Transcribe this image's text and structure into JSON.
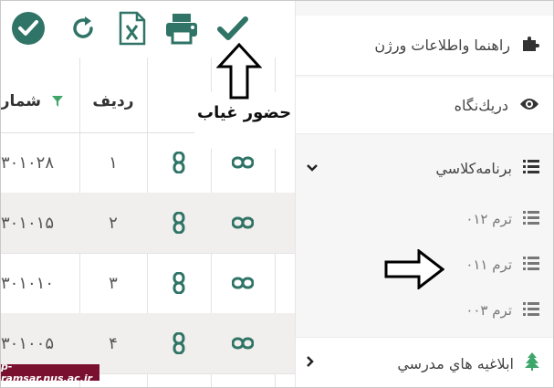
{
  "toolbar": {
    "buttons": [
      {
        "name": "check-circle-icon"
      },
      {
        "name": "refresh-icon"
      },
      {
        "name": "excel-export-icon"
      },
      {
        "name": "print-icon"
      },
      {
        "name": "checkmark-icon"
      }
    ]
  },
  "table": {
    "headers": {
      "number": "شمار",
      "row": "رديف"
    },
    "rows": [
      {
        "number": "۳۰۱۰۲۸",
        "index": "۱"
      },
      {
        "number": "۳۰۱۰۱۵",
        "index": "۲"
      },
      {
        "number": "۳۰۱۰۱۰",
        "index": "۳"
      },
      {
        "number": "۳۰۱۰۰۵",
        "index": "۴"
      }
    ]
  },
  "annotation": {
    "label": "حضور غياب"
  },
  "sidebar": {
    "items": [
      {
        "label": "راهنما واطلاعات ورژن",
        "icon": "puzzle-icon"
      },
      {
        "label": "دريك‌نگاه",
        "icon": "eye-icon"
      },
      {
        "label": "برنامه‌كلاسي",
        "icon": "list-icon"
      },
      {
        "label": "ترم ۰۱۲",
        "icon": "list-icon"
      },
      {
        "label": "ترم ۰۱۱",
        "icon": "list-icon"
      },
      {
        "label": "ترم ۰۰۳",
        "icon": "list-icon"
      },
      {
        "label": "ابلاغيه هاي مدرسي",
        "icon": "tree-icon"
      }
    ]
  },
  "watermark": {
    "text": "p-ramsar.nus.ac.ir"
  },
  "colors": {
    "accent": "#2f7466",
    "green": "#3fa66b",
    "rowAlt": "#f1efed"
  }
}
